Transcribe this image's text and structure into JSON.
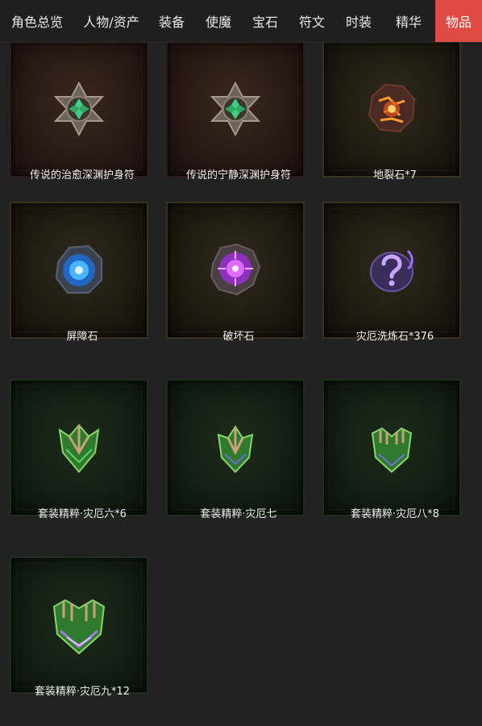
{
  "tabs": [
    {
      "label": "角色总览",
      "active": false
    },
    {
      "label": "人物/资产",
      "active": false
    },
    {
      "label": "装备",
      "active": false
    },
    {
      "label": "使魔",
      "active": false
    },
    {
      "label": "宝石",
      "active": false
    },
    {
      "label": "符文",
      "active": false
    },
    {
      "label": "时装",
      "active": false
    },
    {
      "label": "精华",
      "active": false
    },
    {
      "label": "物品",
      "active": true
    }
  ],
  "accent_color": "#e04a45",
  "items": [
    {
      "name": "传说的治愈深渊护身符",
      "icon": "amulet-icon",
      "rarity": "legendary"
    },
    {
      "name": "传说的宁静深渊护身符",
      "icon": "amulet-icon",
      "rarity": "legendary"
    },
    {
      "name": "地裂石*7",
      "icon": "earth-stone-icon",
      "rarity": "gold"
    },
    {
      "name": "屏障石",
      "icon": "barrier-stone-icon",
      "rarity": "gold"
    },
    {
      "name": "破坏石",
      "icon": "destruction-stone-icon",
      "rarity": "gold"
    },
    {
      "name": "灾厄洗炼石*376",
      "icon": "calamity-reforge-stone-icon",
      "rarity": "gold"
    },
    {
      "name": "套装精粹·灾厄六*6",
      "icon": "set-essence-icon",
      "rarity": "set"
    },
    {
      "name": "套装精粹·灾厄七",
      "icon": "set-essence-icon",
      "rarity": "set"
    },
    {
      "name": "套装精粹·灾厄八*8",
      "icon": "set-essence-icon",
      "rarity": "set"
    },
    {
      "name": "套装精粹·灾厄九*12",
      "icon": "set-essence-icon",
      "rarity": "set"
    }
  ]
}
